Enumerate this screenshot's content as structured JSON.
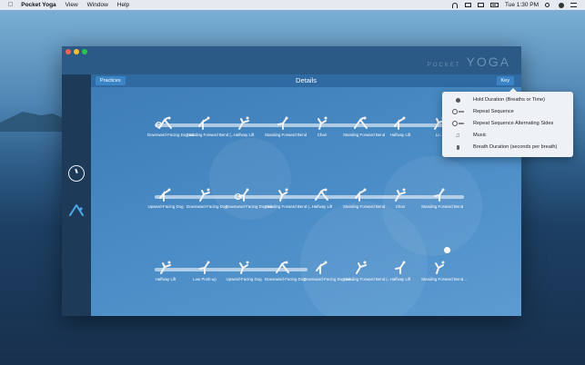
{
  "menubar": {
    "app_name": "Pocket Yoga",
    "menus": [
      "View",
      "Window",
      "Help"
    ],
    "clock": "Tue 1:30 PM"
  },
  "window": {
    "brand_small": "POCKET",
    "brand_large": "YOGA",
    "header": {
      "back_label": "Practices",
      "title": "Details",
      "key_label": "Key"
    }
  },
  "sequence": {
    "rows": [
      [
        "Downward-Facing Dog wit...",
        "Standing Forward Bend (...",
        "Halfway Lift",
        "Standing Forward Bend",
        "Chair",
        "Standing Forward Bend",
        "Halfway Lift",
        "Lo..."
      ],
      [
        "Upward-Facing Dog",
        "Downward-Facing Dog",
        "Downward-Facing Dog wit...",
        "Standing Forward Bend (...",
        "Halfway Lift",
        "Standing Forward Bend",
        "Chair",
        "Standing Forward Bend"
      ],
      [
        "Halfway Lift",
        "Low Push-up",
        "Upward-Facing Dog",
        "Downward-Facing Dog",
        "Downward-Facing Dog wit...",
        "Standing Forward Bend (...",
        "Halfway Lift",
        "Standing Forward Bend..."
      ]
    ]
  },
  "key_popover": {
    "items": [
      {
        "icon": "hold-duration-icon",
        "label": "Hold Duration (Breaths or Time)"
      },
      {
        "icon": "repeat-sequence-icon",
        "label": "Repeat Sequence"
      },
      {
        "icon": "repeat-alternating-icon",
        "label": "Repeat Sequence Alternating Sides"
      },
      {
        "icon": "music-icon",
        "label": "Music"
      },
      {
        "icon": "breath-duration-icon",
        "label": "Breath Duration (seconds per breath)"
      }
    ]
  },
  "colors": {
    "accent": "#3b85c6",
    "sidebar": "#1d3a58",
    "content": "#4a8cc6"
  }
}
